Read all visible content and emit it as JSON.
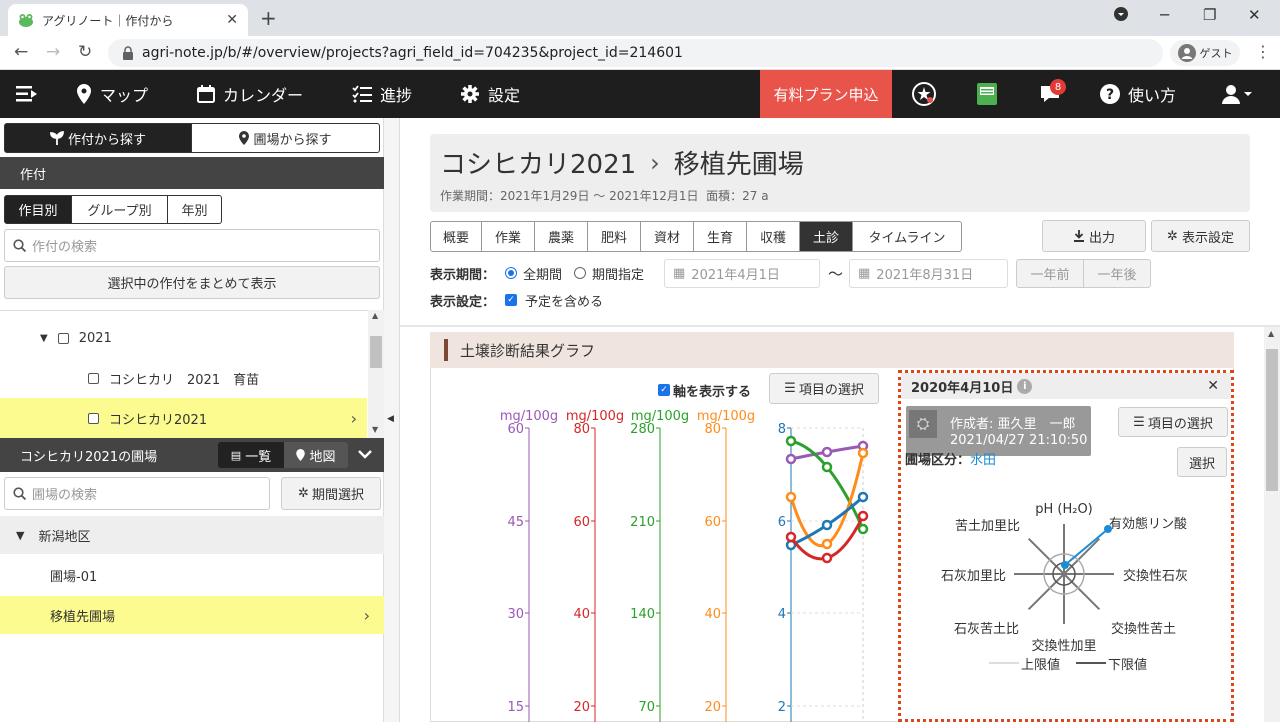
{
  "browser": {
    "tab_title": "アグリノート｜作付から",
    "url": "agri-note.jp/b/#/overview/projects?agri_field_id=704235&project_id=214601",
    "guest": "ゲスト"
  },
  "nav": {
    "map": "マップ",
    "calendar": "カレンダー",
    "progress": "進捗",
    "settings": "設定",
    "plan": "有料プラン申込",
    "badge": "8",
    "help": "使い方"
  },
  "left": {
    "tab_crop": "作付から探す",
    "tab_field": "圃場から探す",
    "section_crop": "作付",
    "seg_item": "作目別",
    "seg_group": "グループ別",
    "seg_year": "年別",
    "crop_search_ph": "作付の検索",
    "show_selected": "選択中の作付をまとめて表示",
    "tree_year": "2021",
    "tree_items": [
      "コシヒカリ　2021　育苗",
      "コシヒカリ2021"
    ],
    "fields_title": "コシヒカリ2021の圃場",
    "view_list": "一覧",
    "view_map": "地図",
    "field_search_ph": "圃場の検索",
    "period_btn": "期間選択",
    "region": "新潟地区",
    "fields": [
      "圃場-01",
      "移植先圃場"
    ]
  },
  "header": {
    "crop": "コシヒカリ2021",
    "field": "移植先圃場",
    "meta": "作業期間：2021年1月29日 〜 2021年12月1日  面積：27 a"
  },
  "tabs": [
    "概要",
    "作業",
    "農薬",
    "肥料",
    "資材",
    "生育",
    "収穫",
    "土診",
    "タイムライン"
  ],
  "export_btn": "出力",
  "display_settings_btn": "表示設定",
  "period": {
    "label": "表示期間：",
    "all": "全期間",
    "specified": "期間指定",
    "from": "2021年4月1日",
    "tilde": "〜",
    "to": "2021年8月31日",
    "prev_year": "一年前",
    "next_year": "一年後"
  },
  "display": {
    "label": "表示設定：",
    "include_plan": "予定を含める"
  },
  "section_title": "土壌診断結果グラフ",
  "chart_controls": {
    "show_axis": "軸を表示する",
    "select_items": "項目の選択"
  },
  "chart_data": {
    "type": "line",
    "axes": [
      {
        "unit": "mg/100g",
        "color": "#9b59b6",
        "ticks": [
          "60",
          "45",
          "30",
          "15"
        ]
      },
      {
        "unit": "mg/100g",
        "color": "#d62728",
        "ticks": [
          "80",
          "60",
          "40",
          "20"
        ]
      },
      {
        "unit": "mg/100g",
        "color": "#2ca02c",
        "ticks": [
          "280",
          "210",
          "140",
          "70"
        ]
      },
      {
        "unit": "mg/100g",
        "color": "#ff8c1a",
        "ticks": [
          "80",
          "60",
          "40",
          "20"
        ]
      },
      {
        "unit": "",
        "color": "#1f77b4",
        "ticks": [
          "8",
          "6",
          "4",
          "2"
        ]
      }
    ],
    "series": [
      {
        "color": "#9b59b6",
        "points": [
          [
            791,
            459
          ],
          [
            827,
            452
          ],
          [
            863,
            446
          ]
        ]
      },
      {
        "color": "#2ca02c",
        "points": [
          [
            791,
            441
          ],
          [
            827,
            467
          ],
          [
            863,
            529
          ]
        ]
      },
      {
        "color": "#ff8c1a",
        "points": [
          [
            791,
            497
          ],
          [
            827,
            544
          ],
          [
            863,
            453
          ]
        ]
      },
      {
        "color": "#1f77b4",
        "points": [
          [
            791,
            545
          ],
          [
            827,
            525
          ],
          [
            863,
            497
          ]
        ]
      },
      {
        "color": "#d62728",
        "points": [
          [
            791,
            537
          ],
          [
            827,
            558
          ],
          [
            863,
            516
          ]
        ]
      }
    ]
  },
  "popup": {
    "date": "2020年4月10日",
    "author": "作成者: 亜久里　一郎",
    "datetime": "2021/04/27 21:10:50",
    "select_items": "項目の選択",
    "select": "選択",
    "field_type_label": "圃場区分：",
    "field_type": "水田",
    "radar_labels": [
      "pH (H₂O)",
      "有効態リン酸",
      "交換性石灰",
      "交換性苦土",
      "交換性加里",
      "石灰苦土比",
      "石灰加里比",
      "苦土加里比"
    ],
    "legend_upper": "上限値",
    "legend_lower": "下限値"
  }
}
